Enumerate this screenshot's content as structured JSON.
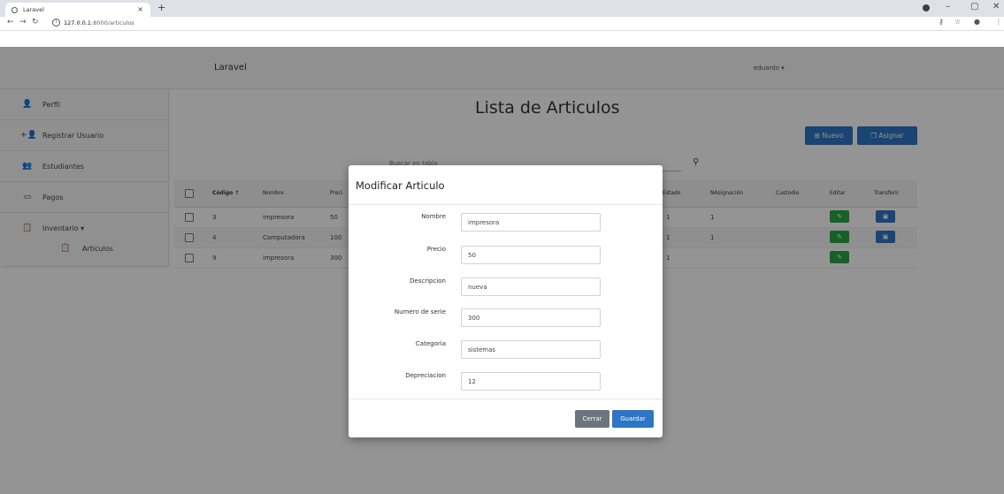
{
  "browser": {
    "tab_title": "Laravel",
    "tab_close": "×",
    "new_tab": "+",
    "url_host": "127.0.0.1",
    "url_path": ":8000/articulos",
    "minimize": "–",
    "maximize": "▢",
    "close": "✕"
  },
  "navbar": {
    "brand": "Laravel",
    "user": "eduardo ▾"
  },
  "sidebar": {
    "items": [
      {
        "label": "Perfil",
        "icon": "👤"
      },
      {
        "label": "Registrar Usuario",
        "icon": "+👤"
      },
      {
        "label": "Estudiantes",
        "icon": "👥"
      },
      {
        "label": "Pagos",
        "icon": "▭"
      },
      {
        "label": "Inventario ▾",
        "icon": "📋"
      }
    ],
    "sub_item": {
      "label": "Articulos",
      "icon": "📋"
    }
  },
  "main": {
    "title": "Lista de Articulos",
    "btn_nuevo": "⊞ Nuevo",
    "btn_asignar": "❐ Asignar",
    "search_placeholder": "Buscar en tabla",
    "columns": {
      "codigo": "Código ↑",
      "nombre": "Nombre",
      "precio": "Preci",
      "estado": "Estado",
      "nasignacion": "NAsignación",
      "custodio": "Custodio",
      "editar": "Editar",
      "transferir": "Transferir"
    },
    "rows": [
      {
        "codigo": "3",
        "nombre": "impresora",
        "precio": "50",
        "estado": "1",
        "nasignacion": "1"
      },
      {
        "codigo": "4",
        "nombre": "Computadora",
        "precio": "100",
        "estado": "1",
        "nasignacion": "1"
      },
      {
        "codigo": "9",
        "nombre": "impresora",
        "precio": "300",
        "estado": "1",
        "nasignacion": ""
      }
    ],
    "edit_icon": "✎",
    "transfer_icon": "▣"
  },
  "modal": {
    "title": "Modificar Articulo",
    "fields": [
      {
        "label": "Nombre",
        "value": "impresora"
      },
      {
        "label": "Precio",
        "value": "50"
      },
      {
        "label": "Descripcion",
        "value": "nueva"
      },
      {
        "label": "Numero de serie",
        "value": "300"
      },
      {
        "label": "Categoria",
        "value": "sistemas"
      },
      {
        "label": "Depreciacion",
        "value": "12"
      }
    ],
    "btn_cerrar": "Cerrar",
    "btn_guardar": "Guardar"
  },
  "colors": {
    "primary": "#2d75c7",
    "success": "#28a745",
    "secondary": "#6c757d"
  }
}
